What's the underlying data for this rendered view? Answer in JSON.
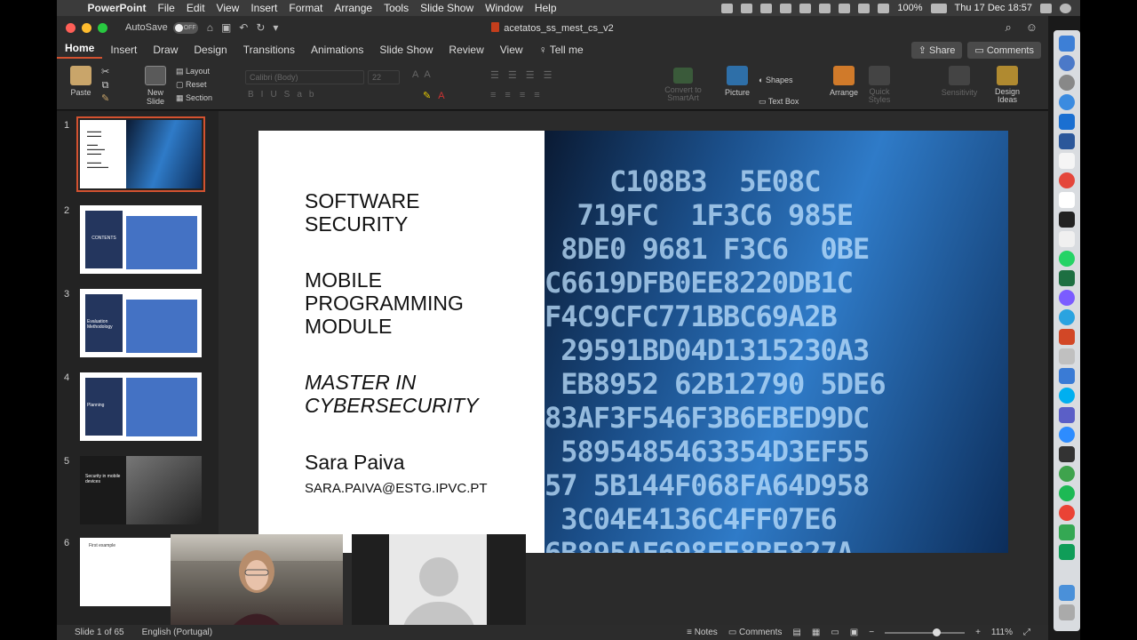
{
  "menubar": {
    "app": "PowerPoint",
    "items": [
      "File",
      "Edit",
      "View",
      "Insert",
      "Format",
      "Arrange",
      "Tools",
      "Slide Show",
      "Window",
      "Help"
    ],
    "battery": "100%",
    "datetime": "Thu 17 Dec  18:57"
  },
  "titlebar": {
    "autosave": "AutoSave",
    "toggle": "OFF",
    "title": "acetatos_ss_mest_cs_v2"
  },
  "tabs": {
    "items": [
      "Home",
      "Insert",
      "Draw",
      "Design",
      "Transitions",
      "Animations",
      "Slide Show",
      "Review",
      "View"
    ],
    "tell_me": "Tell me",
    "share": "Share",
    "comments": "Comments"
  },
  "ribbon": {
    "paste": "Paste",
    "new_slide": "New Slide",
    "layout": "Layout",
    "reset": "Reset",
    "section": "Section",
    "font": "Calibri (Body)",
    "size": "22",
    "convert": "Convert to SmartArt",
    "picture": "Picture",
    "shapes": "Shapes",
    "text_box": "Text Box",
    "arrange": "Arrange",
    "quick_styles": "Quick Styles",
    "sensitivity": "Sensitivity",
    "design_ideas": "Design Ideas"
  },
  "thumbnails": [
    {
      "num": "1"
    },
    {
      "num": "2",
      "title": "CONTENTS"
    },
    {
      "num": "3",
      "title": "Evaluation Methodology"
    },
    {
      "num": "4",
      "title": "Planning"
    },
    {
      "num": "5",
      "title": "Security in mobile devices"
    },
    {
      "num": "6",
      "title": "First example"
    }
  ],
  "slide": {
    "line1": "SOFTWARE",
    "line2": "SECURITY",
    "line3": "MOBILE",
    "line4": "PROGRAMMING",
    "line5": "MODULE",
    "line6": "MASTER IN",
    "line7": "CYBERSECURITY",
    "name": "Sara Paiva",
    "email": "SARA.PAIVA@ESTG.IPVC.PT"
  },
  "status": {
    "slide_info": "Slide 1 of 65",
    "language": "English (Portugal)",
    "notes": "Notes",
    "comments": "Comments",
    "zoom": "111%"
  },
  "colors": {
    "accent": "#d35230",
    "slide_bg": "#ffffff"
  }
}
